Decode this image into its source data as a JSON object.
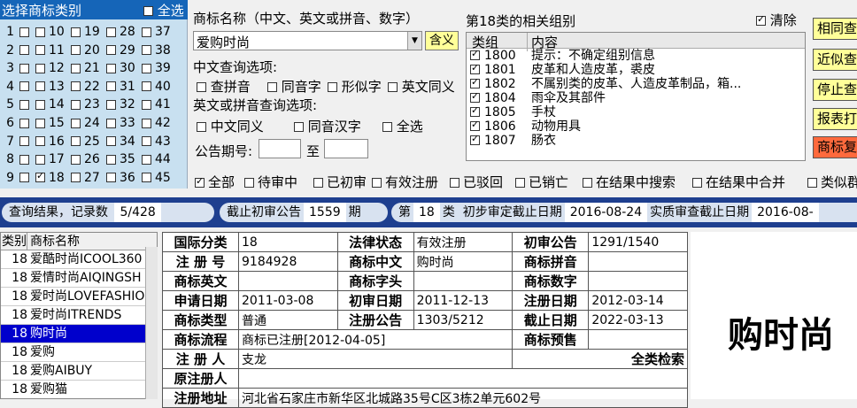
{
  "category_panel": {
    "title": "选择商标类别",
    "all_label": "全选",
    "columns": [
      [
        "1",
        "2",
        "3",
        "4",
        "5",
        "6",
        "7",
        "8",
        "9"
      ],
      [
        "10",
        "11",
        "12",
        "13",
        "14",
        "15",
        "16",
        "17",
        "18"
      ],
      [
        "19",
        "20",
        "21",
        "22",
        "23",
        "24",
        "25",
        "26",
        "27"
      ],
      [
        "28",
        "29",
        "30",
        "31",
        "32",
        "33",
        "34",
        "35",
        "36"
      ],
      [
        "37",
        "38",
        "39",
        "40",
        "41",
        "42",
        "43",
        "44",
        "45"
      ]
    ],
    "checked": "18"
  },
  "query": {
    "name_label": "商标名称（中文、英文或拼音、数字）",
    "name_value": "爱购时尚",
    "meaning_button": "含义",
    "cn_options_label": "中文查询选项:",
    "cn_options": [
      "查拼音",
      "同音字",
      "形似字",
      "英文同义"
    ],
    "en_options_label": "英文或拼音查询选项:",
    "en_options": [
      "中文同义",
      "同音汉字",
      "全选"
    ],
    "announce_label": "公告期号:",
    "to_label": "至"
  },
  "groups": {
    "title": "第18类的相关组别",
    "clear_label": "清除",
    "headers": [
      "类组",
      "内容"
    ],
    "rows": [
      {
        "code": "1800",
        "desc": "提示：不确定组别信息"
      },
      {
        "code": "1801",
        "desc": "皮革和人造皮革，裘皮"
      },
      {
        "code": "1802",
        "desc": "不属别类的皮革、人造皮革制品，箱..."
      },
      {
        "code": "1804",
        "desc": "雨伞及其部件"
      },
      {
        "code": "1805",
        "desc": "手杖"
      },
      {
        "code": "1806",
        "desc": "动物用具"
      },
      {
        "code": "1807",
        "desc": "肠衣"
      }
    ]
  },
  "right_buttons": [
    "相同查",
    "近似查",
    "停止查",
    "报表打",
    "商标复"
  ],
  "filters": [
    "全部",
    "待审中",
    "已初审",
    "有效注册",
    "已驳回",
    "已销亡",
    "在结果中搜索",
    "在结果中合并",
    "类似群"
  ],
  "status_bar": {
    "result_label": "查询结果，记录数",
    "result_value": "5/428",
    "cutoff_label": "截止初审公告",
    "cutoff_value": "1559",
    "cutoff_unit": "期",
    "class_prefix": "第",
    "class_value": "18",
    "class_unit": "类",
    "prelim_label": "初步审定截止日期",
    "prelim_value": "2016-08-24",
    "substantive_label": "实质审查截止日期",
    "substantive_value": "2016-08-"
  },
  "results": {
    "headers": [
      "类别",
      "商标名称"
    ],
    "rows": [
      {
        "cls": "18",
        "name": "爱酷时尚ICOOL360"
      },
      {
        "cls": "18",
        "name": "爱情时尚AIQINGSH"
      },
      {
        "cls": "18",
        "name": "爱时尚LOVEFASHIO"
      },
      {
        "cls": "18",
        "name": "爱时尚ITRENDS"
      },
      {
        "cls": "18",
        "name": "购时尚"
      },
      {
        "cls": "18",
        "name": "爱购"
      },
      {
        "cls": "18",
        "name": "爱购AIBUY"
      },
      {
        "cls": "18",
        "name": "爱购猫"
      }
    ],
    "selected": 4
  },
  "details": {
    "intl_class_k": "国际分类",
    "intl_class": "18",
    "legal_status_k": "法律状态",
    "legal_status": "有效注册",
    "prelim_ann_k": "初审公告",
    "prelim_ann": "1291/1540",
    "reg_no_k": "注 册 号",
    "reg_no": "9184928",
    "name_cn_k": "商标中文",
    "name_cn": "购时尚",
    "pinyin_k": "商标拼音",
    "pinyin": "",
    "name_en_k": "商标英文",
    "name_en": "",
    "head_k": "商标字头",
    "head": "",
    "digits_k": "商标数字",
    "digits": "",
    "apply_date_k": "申请日期",
    "apply_date": "2011-03-08",
    "prelim_date_k": "初审日期",
    "prelim_date": "2011-12-13",
    "reg_date_k": "注册日期",
    "reg_date": "2012-03-14",
    "type_k": "商标类型",
    "type": "普通",
    "reg_ann_k": "注册公告",
    "reg_ann": "1303/5212",
    "expiry_k": "截止日期",
    "expiry": "2022-03-13",
    "flow_k": "商标流程",
    "flow": "商标已注册[2012-04-05]",
    "presale_k": "商标预售",
    "presale": "",
    "registrant_k": "注 册 人",
    "registrant": "支龙",
    "all_search": "全类检索",
    "orig_k": "原注册人",
    "orig": "",
    "address_k": "注册地址",
    "address": "河北省石家庄市新华区北城路35号C区3栋2单元602号"
  },
  "big_name": "购时尚"
}
